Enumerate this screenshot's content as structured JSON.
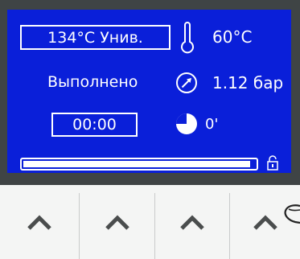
{
  "display": {
    "program_label": "134°C Унив.",
    "temperature": "60°C",
    "status": "Выполнено",
    "pressure": "1.12 бар",
    "timer": "00:00",
    "time_elapsed": "0'",
    "progress_fraction": 0.98,
    "colors": {
      "screen": "#0a1fd9",
      "text": "#ffffff",
      "frame": "#3f4445"
    },
    "icons": [
      "thermometer-icon",
      "pressure-gauge-icon",
      "pie-clock-icon",
      "unlock-icon"
    ]
  },
  "keypad": {
    "keys": [
      {
        "icon": "chevron-up-icon"
      },
      {
        "icon": "chevron-up-icon"
      },
      {
        "icon": "chevron-up-icon"
      },
      {
        "icon": "chevron-up-icon"
      }
    ]
  }
}
